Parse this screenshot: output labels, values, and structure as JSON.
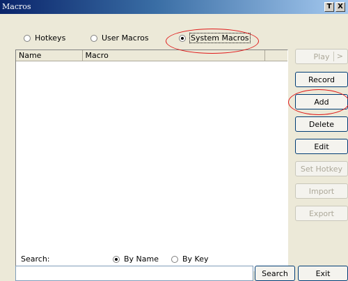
{
  "window": {
    "title": "Macros",
    "help_label": "T",
    "close_label": "X"
  },
  "macro_type": {
    "options": [
      {
        "label": "Hotkeys",
        "checked": false
      },
      {
        "label": "User Macros",
        "checked": false
      },
      {
        "label": "System Macros",
        "checked": true
      }
    ]
  },
  "list": {
    "columns": [
      "Name",
      "Macro"
    ]
  },
  "buttons": {
    "play": {
      "label": "Play",
      "arrow": ">",
      "disabled": true
    },
    "record": {
      "label": "Record",
      "disabled": false
    },
    "add": {
      "label": "Add",
      "disabled": false
    },
    "delete": {
      "label": "Delete",
      "disabled": false
    },
    "edit": {
      "label": "Edit",
      "disabled": false
    },
    "set_hotkey": {
      "label": "Set Hotkey",
      "disabled": true
    },
    "import": {
      "label": "Import",
      "disabled": true
    },
    "export": {
      "label": "Export",
      "disabled": true
    },
    "search": {
      "label": "Search",
      "disabled": false
    },
    "exit": {
      "label": "Exit",
      "disabled": false
    }
  },
  "search": {
    "label": "Search:",
    "value": "",
    "options": [
      {
        "label": "By Name",
        "checked": true
      },
      {
        "label": "By Key",
        "checked": false
      }
    ]
  },
  "annotations": {
    "highlight_color": "#e01818"
  }
}
